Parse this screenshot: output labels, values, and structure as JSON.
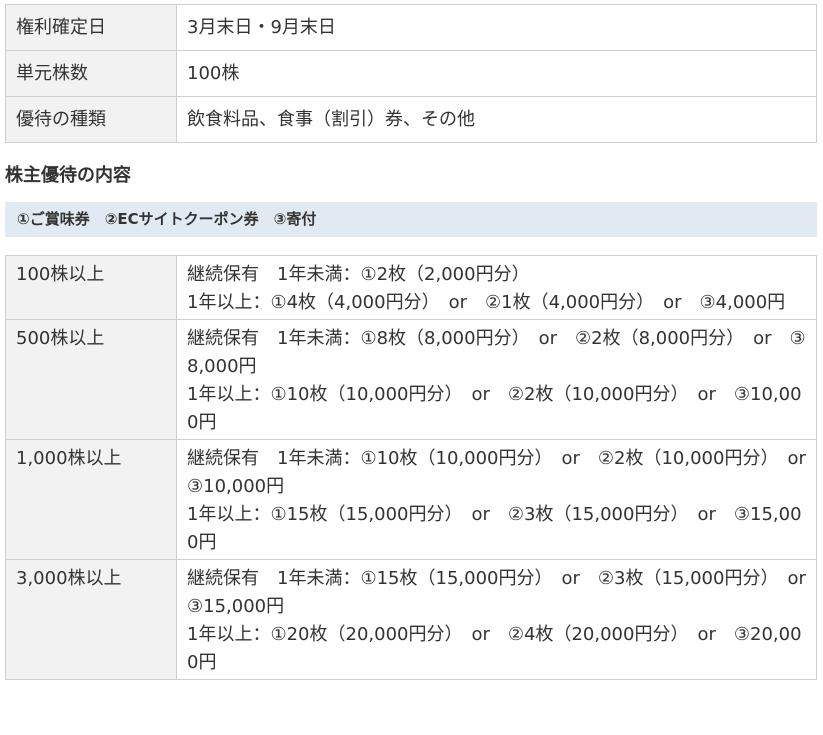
{
  "info_rows": [
    {
      "label": "権利確定日",
      "value": "3月末日・9月末日"
    },
    {
      "label": "単元株数",
      "value": "100株"
    },
    {
      "label": "優待の種類",
      "value": "飲食料品、食事（割引）券、その他"
    }
  ],
  "section_heading": "株主優待の内容",
  "summary": "①ご賞味券　②ECサイトクーポン券　③寄付",
  "benefit_rows": [
    {
      "label": "100株以上",
      "lines": [
        "継続保有　1年未満：①2枚（2,000円分）",
        "1年以上：①4枚（4,000円分）　or　②1枚（4,000円分）　or　③4,000円"
      ]
    },
    {
      "label": "500株以上",
      "lines": [
        "継続保有　1年未満：①8枚（8,000円分）　or　②2枚（8,000円分）　or　③8,000円",
        "1年以上：①10枚（10,000円分）　or　②2枚（10,000円分）　or　③10,000円"
      ]
    },
    {
      "label": "1,000株以上",
      "lines": [
        "継続保有　1年未満：①10枚（10,000円分）　or　②2枚（10,000円分）　or　③10,000円",
        "1年以上：①15枚（15,000円分）　or　②3枚（15,000円分）　or　③15,000円"
      ]
    },
    {
      "label": "3,000株以上",
      "lines": [
        "継続保有　1年未満：①15枚（15,000円分）　or　②3枚（15,000円分）　or　③15,000円",
        "1年以上：①20枚（20,000円分）　or　②4枚（20,000円分）　or　③20,000円"
      ]
    }
  ]
}
